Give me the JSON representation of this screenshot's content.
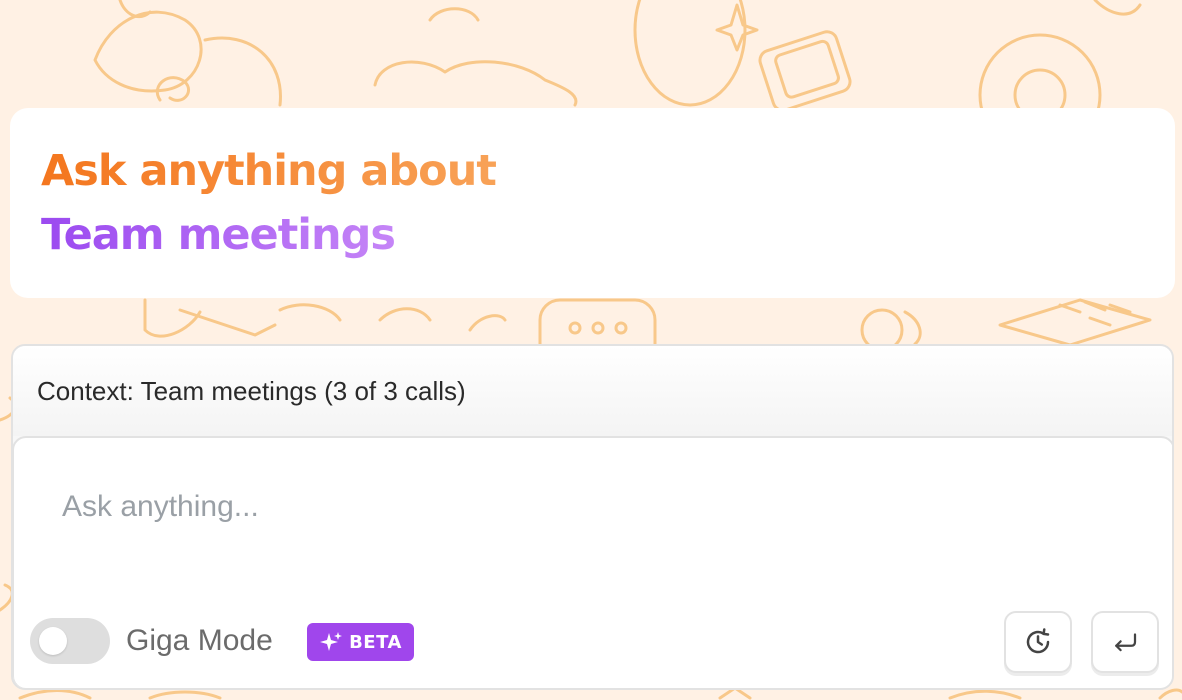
{
  "hero": {
    "line1": "Ask anything about",
    "line2": "Team meetings"
  },
  "context": {
    "label": "Context: Team meetings (3 of 3 calls)"
  },
  "composer": {
    "placeholder": "Ask anything...",
    "value": ""
  },
  "giga_mode": {
    "label": "Giga Mode",
    "enabled": false,
    "badge": "BETA"
  },
  "actions": {
    "history_icon": "history-icon",
    "send_icon": "enter-icon"
  },
  "colors": {
    "background": "#fff1e4",
    "doodle": "#f8c88a",
    "hero_orange": "#f4761e",
    "hero_purple": "#9b4af0",
    "beta": "#a046ec"
  }
}
